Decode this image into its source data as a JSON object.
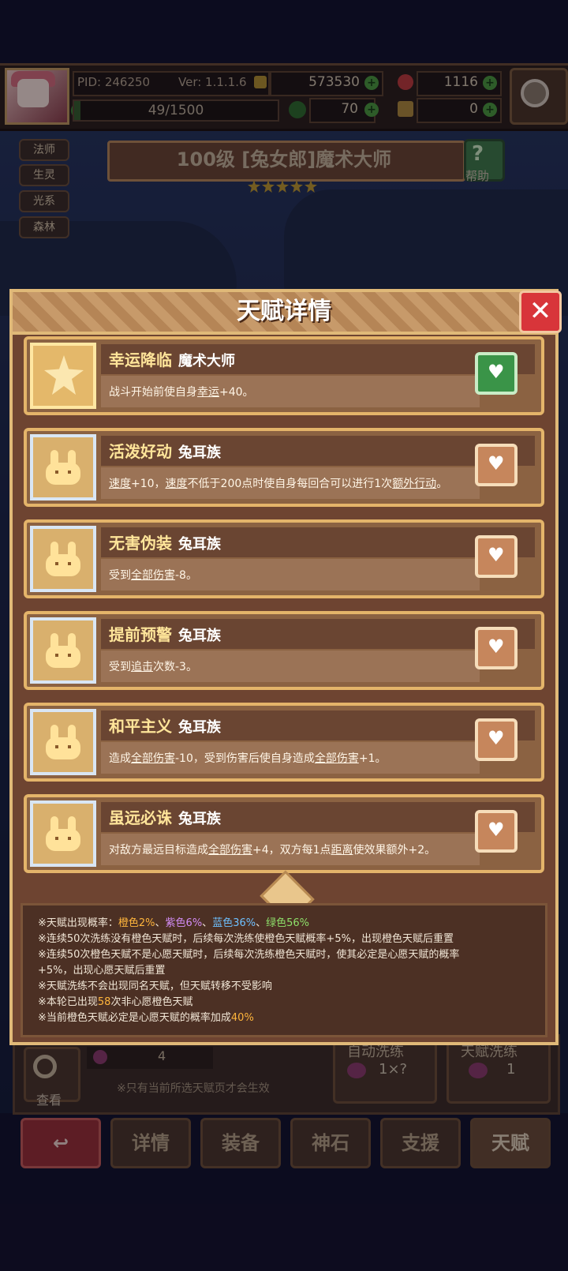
{
  "hud": {
    "pid": "PID: 246250",
    "version": "Ver: 1.1.1.6",
    "gold": "573530",
    "gems": "1116",
    "exp_text": "49/1500",
    "exp_fraction": 0.0327,
    "clover": "70",
    "keys": "0"
  },
  "tags": [
    "法师",
    "生灵",
    "光系",
    "森林"
  ],
  "hero": {
    "title": "100级 [兔女郎]魔术大师",
    "stars": 5,
    "help_label": "帮助"
  },
  "modal": {
    "title": "天赋详情",
    "close_icon": "✕",
    "talents": [
      {
        "name": "幸运降临",
        "tribe": "魔术大师",
        "desc": [
          {
            "t": "战斗开始前使自身"
          },
          {
            "u": "幸运"
          },
          {
            "t": "+40。"
          }
        ],
        "frame": "gold",
        "wish": true
      },
      {
        "name": "活泼好动",
        "tribe": "兔耳族",
        "desc": [
          {
            "u": "速度"
          },
          {
            "t": "+10，"
          },
          {
            "u": "速度"
          },
          {
            "t": "不低于200点时使自身每回合可以进行1次"
          },
          {
            "u": "额外行动"
          },
          {
            "t": "。"
          }
        ],
        "frame": "blue",
        "wish": false
      },
      {
        "name": "无害伪装",
        "tribe": "兔耳族",
        "desc": [
          {
            "t": "受到"
          },
          {
            "u": "全部伤害"
          },
          {
            "t": "-8。"
          }
        ],
        "frame": "blue",
        "wish": false
      },
      {
        "name": "提前预警",
        "tribe": "兔耳族",
        "desc": [
          {
            "t": "受到"
          },
          {
            "u": "追击"
          },
          {
            "t": "次数-3。"
          }
        ],
        "frame": "blue",
        "wish": false
      },
      {
        "name": "和平主义",
        "tribe": "兔耳族",
        "desc": [
          {
            "t": "造成"
          },
          {
            "u": "全部伤害"
          },
          {
            "t": "-10，受到伤害后使自身造成"
          },
          {
            "u": "全部伤害"
          },
          {
            "t": "+1。"
          }
        ],
        "frame": "blue",
        "wish": false
      },
      {
        "name": "虽远必诛",
        "tribe": "兔耳族",
        "desc": [
          {
            "t": "对敌方最远目标造成"
          },
          {
            "u": "全部伤害"
          },
          {
            "t": "+4，双方每1点"
          },
          {
            "u": "距离"
          },
          {
            "t": "使效果额外+2。"
          }
        ],
        "frame": "blue",
        "wish": false
      }
    ],
    "notes": {
      "line1_prefix": "※天赋出现概率：",
      "rate_orange": "橙色2%",
      "sep1": "、",
      "rate_purple": "紫色6%",
      "sep2": "、",
      "rate_blue": "蓝色36%",
      "sep3": "、",
      "rate_green": "绿色56%",
      "line2": "※连续50次洗练没有橙色天赋时，后续每次洗练使橙色天赋概率+5%，出现橙色天赋后重置",
      "line3a": "※连续50次橙色天赋不是心愿天赋时，后续每次洗练橙色天赋时，使其必定是心愿天赋的概率",
      "line3b": "+5%，出现心愿天赋后重置",
      "line4": "※天赋洗练不会出现同名天赋，但天赋转移不受影响",
      "line5_prefix": "※本轮已出现",
      "line5_count": "58",
      "line5_suffix": "次非心愿橙色天赋",
      "line6_prefix": "※当前橙色天赋必定是心愿天赋的概率加成",
      "line6_value": "40%"
    }
  },
  "under": {
    "search_label": "查看",
    "count": "4",
    "hint": "※只有当前所选天赋页才会生效",
    "auto_label": "自动洗练",
    "auto_value": "1×?",
    "wash_label": "天赋洗练",
    "wash_value": "1",
    "nav": [
      "详情",
      "装备",
      "神石",
      "支援",
      "天赋"
    ]
  },
  "colors": {
    "orange": "#ffb53c",
    "purple": "#d28cf5",
    "blue": "#6ec0ff",
    "green": "#8ee06a"
  }
}
